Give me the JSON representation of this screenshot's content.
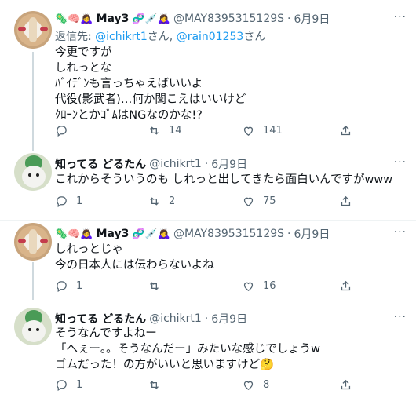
{
  "tweets": [
    {
      "emoji_before": "🦠🧠🙇‍♀️",
      "name": "May3",
      "emoji_after": "🧬💉🙇‍♀️",
      "handle": "@MAY8395315129S",
      "sep": "·",
      "date": "6月9日",
      "reply_to_prefix": "返信先: ",
      "reply_to_user1": "@ichikrt1",
      "reply_to_mid": "さん, ",
      "reply_to_user2": "@rain01253",
      "reply_to_suffix": "さん",
      "lines": [
        "今更ですが",
        "しれっとな",
        "ﾊﾞｲﾃﾞﾝも言っちゃえばいいよ",
        "代役(影武者)…何か聞こえはいいけど",
        "ｸﾛｰﾝとかｺﾞﾑはNGなのかな!?"
      ],
      "reply_count": "",
      "retweet_count": "14",
      "like_count": "141"
    },
    {
      "name": "知ってる どるたん",
      "handle": "@ichikrt1",
      "sep": "·",
      "date": "6月9日",
      "lines": [
        "これからそういうのも しれっと出してきたら面白いんですがwww"
      ],
      "reply_count": "1",
      "retweet_count": "2",
      "like_count": "75"
    },
    {
      "emoji_before": "🦠🧠🙇‍♀️",
      "name": "May3",
      "emoji_after": "🧬💉🙇‍♀️",
      "handle": "@MAY8395315129S",
      "sep": "·",
      "date": "6月9日",
      "lines": [
        "しれっとじゃ",
        "今の日本人には伝わらないよね"
      ],
      "reply_count": "1",
      "retweet_count": "",
      "like_count": "16"
    },
    {
      "name": "知ってる どるたん",
      "handle": "@ichikrt1",
      "sep": "·",
      "date": "6月9日",
      "lines": [
        "そうなんですよねー",
        "「へぇー。。そうなんだー」みたいな感じでしょうw",
        "ゴムだった！の方がいいと思いますけど🤔"
      ],
      "reply_count": "1",
      "retweet_count": "",
      "like_count": "8"
    }
  ],
  "more_label": "···",
  "colors": {
    "link": "#1d9bf0",
    "meta": "#536471",
    "divider": "#eff3f4",
    "thread": "#cfd9de"
  }
}
